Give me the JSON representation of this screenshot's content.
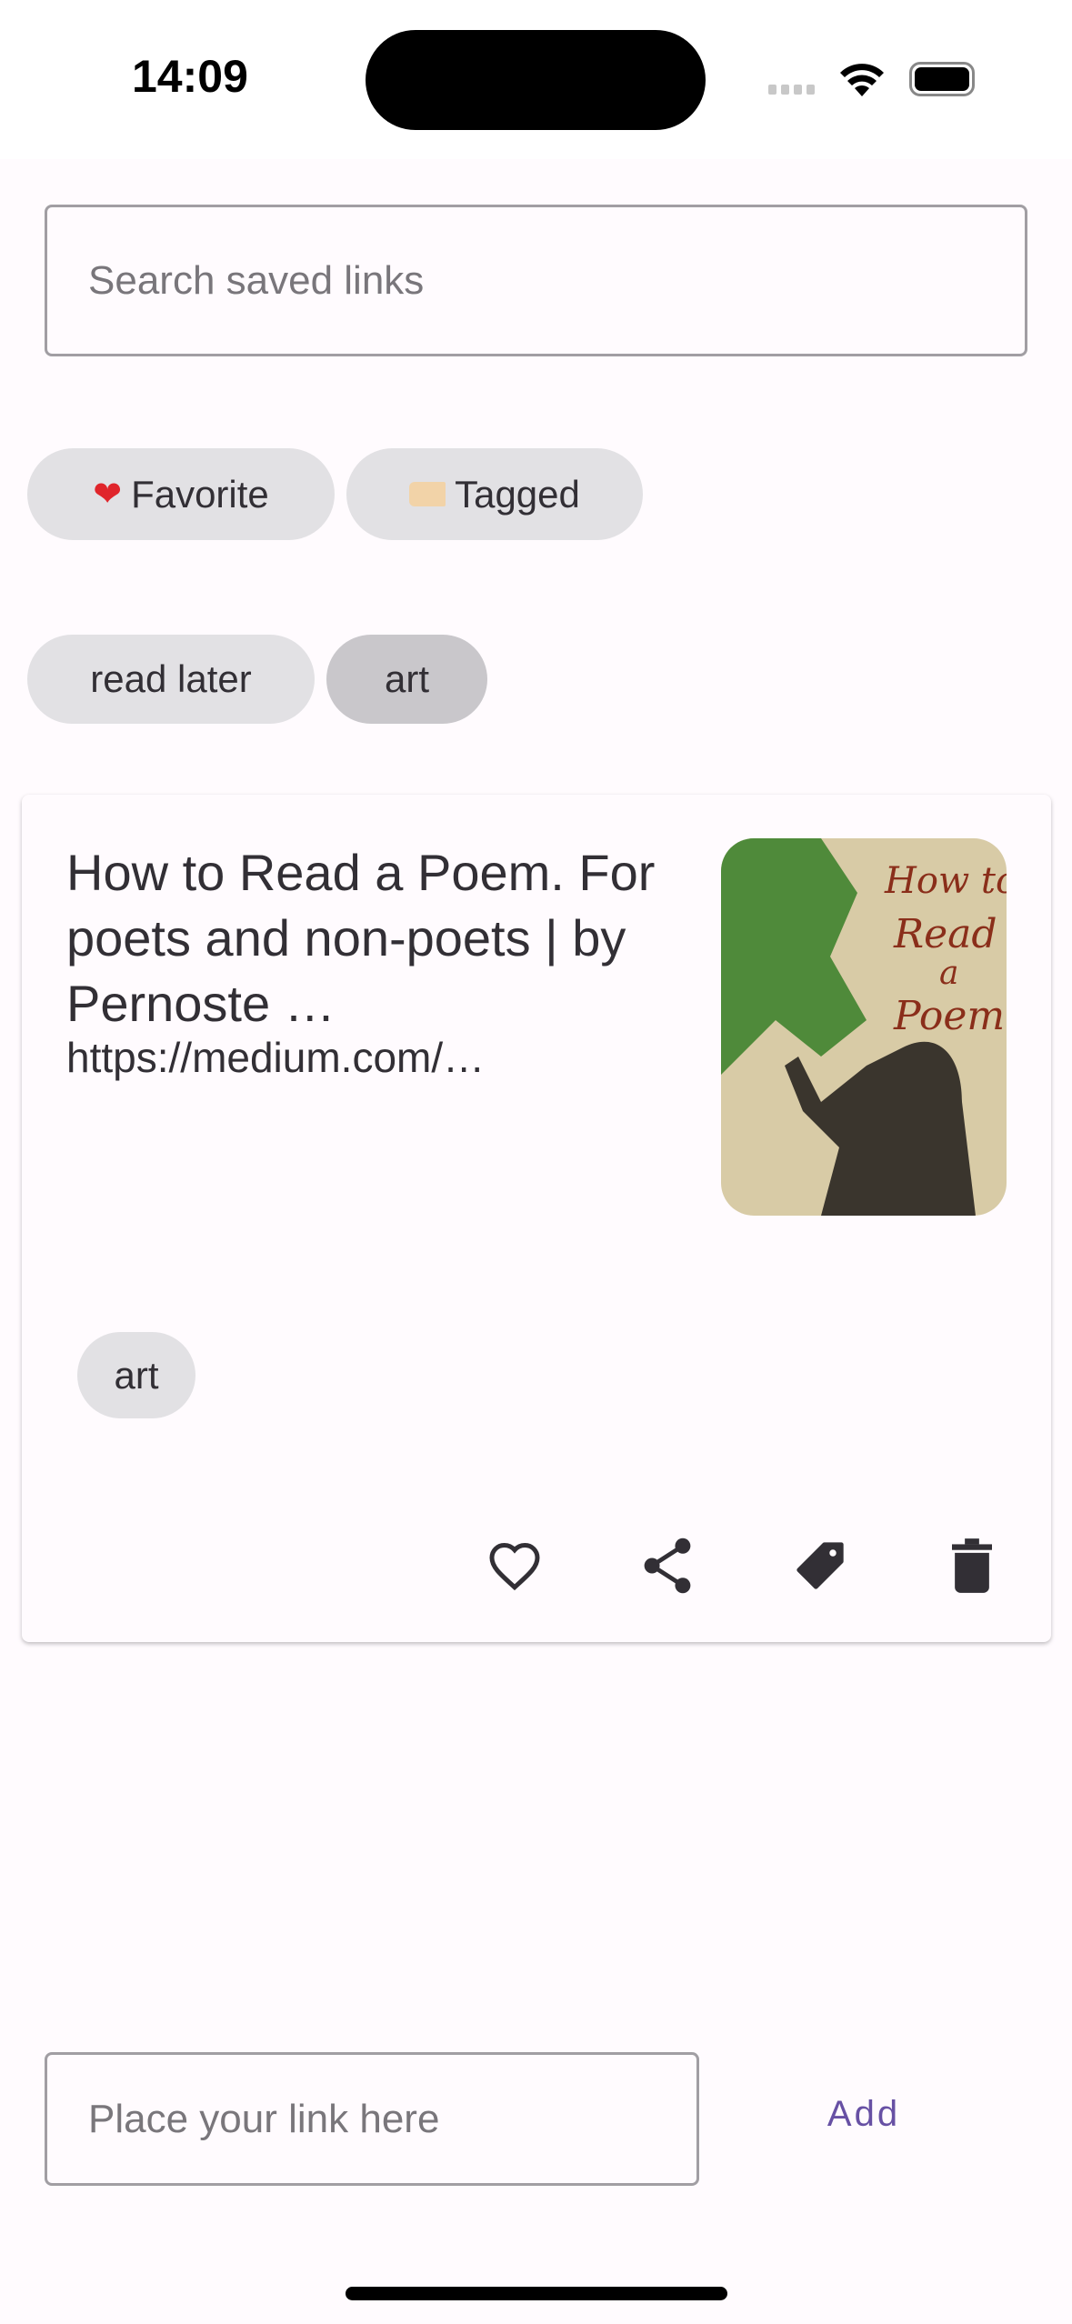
{
  "status_bar": {
    "time": "14:09"
  },
  "search": {
    "placeholder": "Search saved links",
    "value": ""
  },
  "filters": [
    {
      "icon": "heart-emoji",
      "label": "Favorite"
    },
    {
      "icon": "tag-emoji",
      "label": "Tagged"
    }
  ],
  "tags": [
    {
      "label": "read later",
      "selected": false
    },
    {
      "label": "art",
      "selected": true
    }
  ],
  "links": [
    {
      "title": "How to Read a Poem. For poets and non-poets | by Pernoste …",
      "url": "https://medium.com/…",
      "thumbnail_text": "How to Read a Poem",
      "tags": [
        "art"
      ],
      "actions": [
        "favorite",
        "share",
        "tag",
        "delete"
      ]
    }
  ],
  "add_link": {
    "placeholder": "Place your link here",
    "value": "",
    "button": "Add"
  },
  "colors": {
    "accent": "#6750a4",
    "background": "#fffbfe",
    "chip": "#e2e1e4",
    "chip_selected": "#c9c7cb"
  }
}
